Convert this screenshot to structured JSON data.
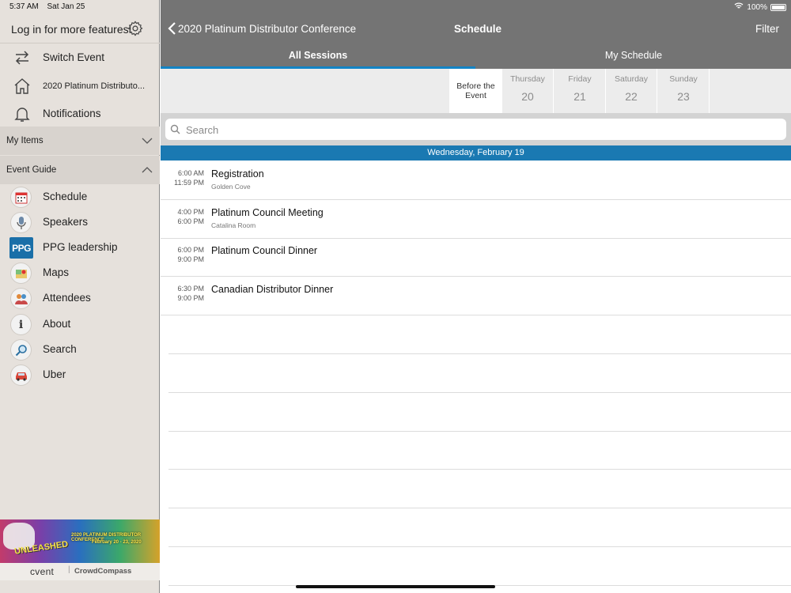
{
  "status": {
    "time": "5:37 AM",
    "date": "Sat Jan 25",
    "battery": "100%"
  },
  "sidebar": {
    "login_text": "Log in for more features!",
    "nav": [
      {
        "label": "Switch Event",
        "icon": "switch-arrows-icon"
      },
      {
        "label": "2020 Platinum Distributo...",
        "icon": "home-icon"
      },
      {
        "label": "Notifications",
        "icon": "bell-icon"
      }
    ],
    "my_items_label": "My Items",
    "event_guide_label": "Event Guide",
    "guide": [
      {
        "label": "Schedule",
        "icon": "calendar-icon"
      },
      {
        "label": "Speakers",
        "icon": "microphone-icon"
      },
      {
        "label": "PPG leadership",
        "icon": "ppg-logo"
      },
      {
        "label": "Maps",
        "icon": "map-icon"
      },
      {
        "label": "Attendees",
        "icon": "people-icon"
      },
      {
        "label": "About",
        "icon": "info-icon"
      },
      {
        "label": "Search",
        "icon": "magnifier-icon"
      },
      {
        "label": "Uber",
        "icon": "car-icon"
      }
    ],
    "ppg_text": "PPG",
    "banner": {
      "title": "UNLEASHED",
      "conference": "2020 PLATINUM DISTRIBUTOR CONFERENCE",
      "dates": "February 20 - 23, 2020"
    },
    "brand": {
      "cvent": "cvent",
      "separator": "|",
      "crowdcompass": "CrowdCompass"
    }
  },
  "header": {
    "back_label": "2020 Platinum Distributor Conference",
    "title": "Schedule",
    "filter_label": "Filter"
  },
  "tabs": [
    {
      "label": "All Sessions",
      "active": true
    },
    {
      "label": "My Schedule",
      "active": false
    }
  ],
  "days": [
    {
      "name": "Before the Event",
      "number": "",
      "active": true
    },
    {
      "name": "Thursday",
      "number": "20",
      "active": false
    },
    {
      "name": "Friday",
      "number": "21",
      "active": false
    },
    {
      "name": "Saturday",
      "number": "22",
      "active": false
    },
    {
      "name": "Sunday",
      "number": "23",
      "active": false
    }
  ],
  "search": {
    "placeholder": "Search",
    "value": ""
  },
  "date_header": "Wednesday, February 19",
  "sessions": [
    {
      "start": "6:00 AM",
      "end": "11:59 PM",
      "title": "Registration",
      "location": "Golden Cove"
    },
    {
      "start": "4:00 PM",
      "end": "6:00 PM",
      "title": "Platinum Council Meeting",
      "location": "Catalina Room"
    },
    {
      "start": "6:00 PM",
      "end": "9:00 PM",
      "title": "Platinum Council Dinner",
      "location": ""
    },
    {
      "start": "6:30 PM",
      "end": "9:00 PM",
      "title": "Canadian Distributor Dinner",
      "location": ""
    }
  ],
  "colors": {
    "accent": "#1384c5",
    "date_bar": "#1a79b2",
    "topbar": "#747474",
    "sidebar_bg": "#e6e1dc"
  }
}
